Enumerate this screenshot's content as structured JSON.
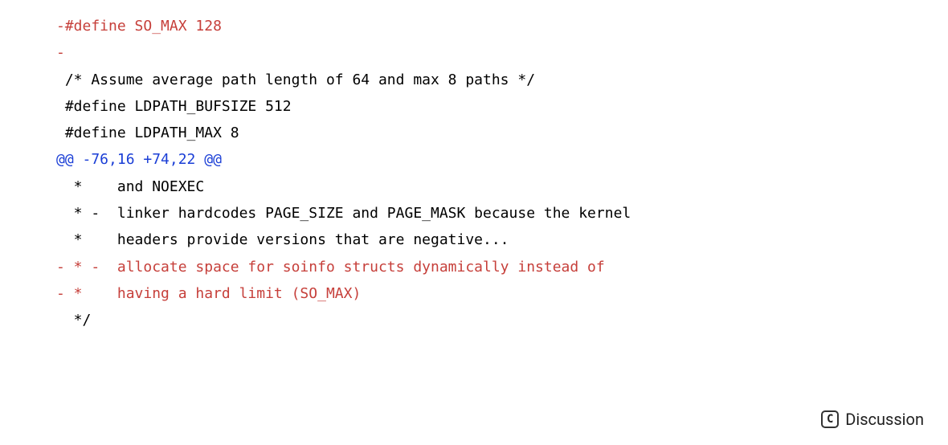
{
  "diff": {
    "lines": [
      {
        "cls": "del",
        "text": "-#define SO_MAX 128"
      },
      {
        "cls": "del",
        "text": "-"
      },
      {
        "cls": "ctx",
        "text": " /* Assume average path length of 64 and max 8 paths */"
      },
      {
        "cls": "ctx",
        "text": " #define LDPATH_BUFSIZE 512"
      },
      {
        "cls": "ctx",
        "text": " #define LDPATH_MAX 8"
      },
      {
        "cls": "hunk",
        "text": "@@ -76,16 +74,22 @@"
      },
      {
        "cls": "ctx",
        "text": "  *    and NOEXEC"
      },
      {
        "cls": "ctx",
        "text": "  * -  linker hardcodes PAGE_SIZE and PAGE_MASK because the kernel"
      },
      {
        "cls": "ctx",
        "text": "  *    headers provide versions that are negative..."
      },
      {
        "cls": "del",
        "text": "- * -  allocate space for soinfo structs dynamically instead of"
      },
      {
        "cls": "del",
        "text": "- *    having a hard limit (SO_MAX)"
      },
      {
        "cls": "ctx",
        "text": "  */"
      }
    ]
  },
  "discussion": {
    "icon_letter": "C",
    "label": "Discussion"
  }
}
